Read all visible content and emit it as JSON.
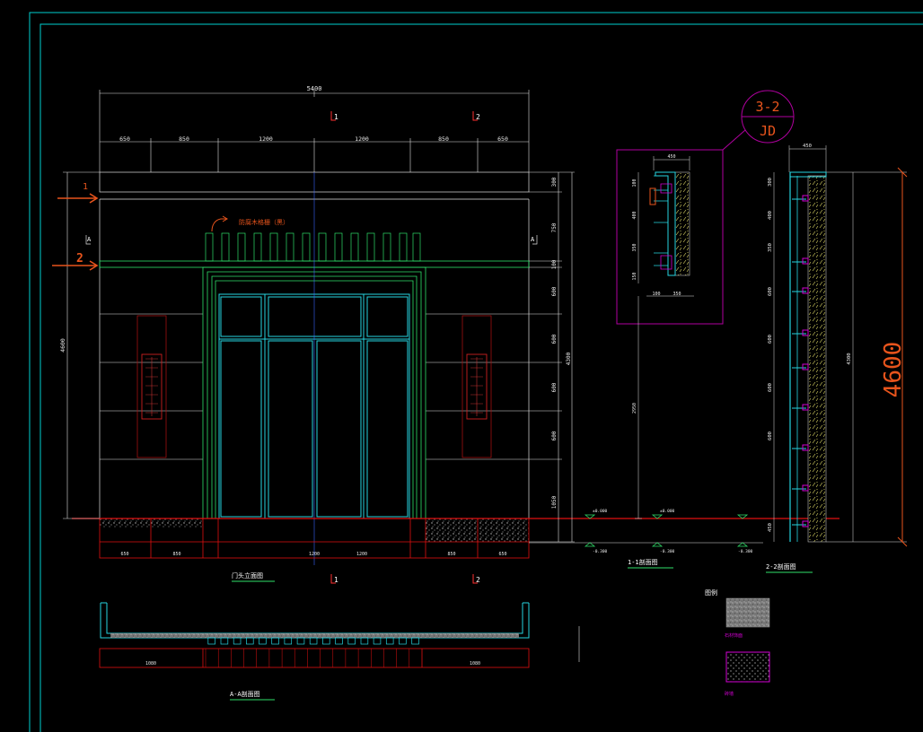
{
  "drawing": {
    "colors": {
      "background": "#000000",
      "frame_cyan": "#00cfcf",
      "dim_white": "#e0e0e0",
      "elevation_green": "#2fe06a",
      "cyan": "#26d4e0",
      "ground_red": "#e01010",
      "annotation_orange": "#e8541c",
      "detail_magenta": "#b0009f"
    },
    "elevation": {
      "total_width": "5400",
      "width_segments": [
        "650",
        "850",
        "1200",
        "1200",
        "850",
        "650"
      ],
      "section_cut_1": "1",
      "section_cut_2": "2",
      "section_mark_a": "A",
      "height_total": "4600",
      "height_inner": "4300",
      "height_segments": [
        "300",
        "750",
        "100",
        "600",
        "600",
        "600",
        "600",
        "1050"
      ],
      "material_note": "防腐木格栅（黑）",
      "arrow_marker_1": "1",
      "arrow_marker_2": "2",
      "title": "门头立面图",
      "bottom_labels": [
        "650",
        "850",
        "1200",
        "1200",
        "850",
        "650"
      ]
    },
    "plan_section": {
      "title": "A-A剖面图",
      "left_label": "1080",
      "right_label": "1080",
      "slat_count": 17
    },
    "detail_callout": {
      "number": "3-2",
      "ref": "JD",
      "top_width": "450",
      "bottom_left": "100",
      "bottom_right": "350",
      "height_segments": [
        "100",
        "400",
        "350",
        "150"
      ]
    },
    "section_1": {
      "title": "1-1剖面图",
      "height_label": "2950",
      "levels": [
        "±0.000",
        "±0.000",
        "-0.300",
        "-0.300",
        "-0.300"
      ]
    },
    "section_2": {
      "title": "2-2剖面图",
      "top_width": "450",
      "height_segments": [
        "300",
        "400",
        "350",
        "600",
        "600",
        "600",
        "600",
        "450"
      ],
      "inner_height": "4300",
      "big_dimension": "4600"
    },
    "legend": {
      "title": "图例",
      "items": [
        "石材饰面",
        "砖墙"
      ]
    }
  }
}
